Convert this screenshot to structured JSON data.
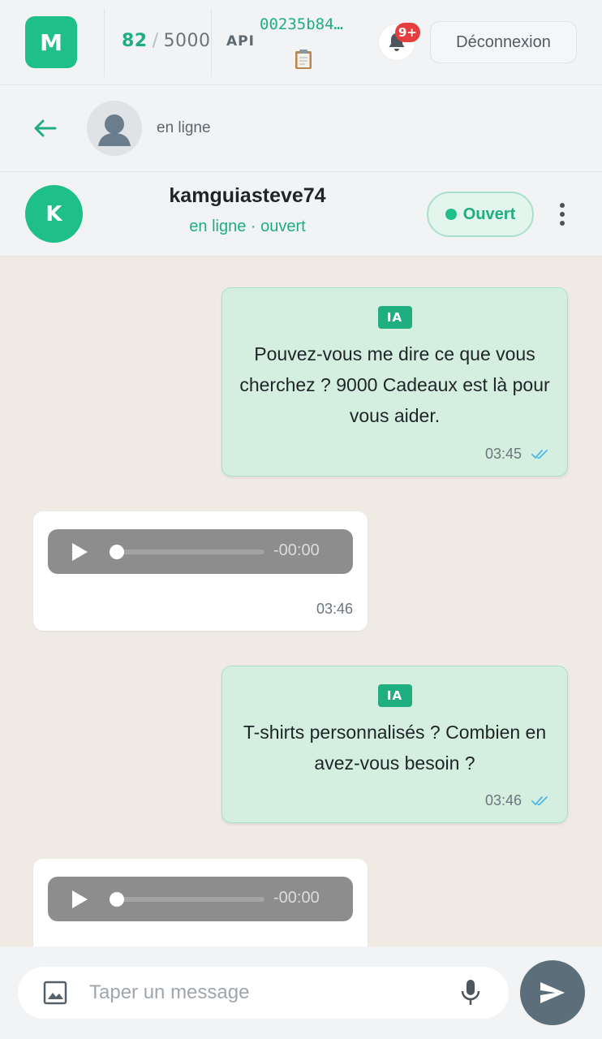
{
  "topbar": {
    "logo_letter": "M",
    "quota_used": "82",
    "quota_separator": "/",
    "quota_total": "5000",
    "api_label": "API",
    "api_key": "00235b84…",
    "notification_badge": "9+",
    "logout_label": "Déconnexion"
  },
  "subbar": {
    "status": "en ligne"
  },
  "contact": {
    "initial": "K",
    "name": "kamguiasteve74",
    "subtitle": "en ligne · ouvert",
    "status_pill": "Ouvert"
  },
  "messages": [
    {
      "direction": "out",
      "tag": "IA",
      "text": "Pouvez-vous me dire ce que vous cherchez ? 9000 Cadeaux est là pour vous aider.",
      "time": "03:45",
      "read": true
    },
    {
      "direction": "in",
      "type": "audio",
      "audio_time": "-00:00",
      "time": "03:46"
    },
    {
      "direction": "out",
      "tag": "IA",
      "text": "T-shirts personnalisés ? Combien en avez-vous besoin ?",
      "time": "03:46",
      "read": true
    },
    {
      "direction": "in",
      "type": "audio",
      "audio_time": "-00:00",
      "time": ""
    }
  ],
  "composer": {
    "placeholder": "Taper un message"
  },
  "colors": {
    "accent": "#1fbf8a",
    "outgoing_bubble": "#d4efe0",
    "chat_background": "#efebe4",
    "send_button": "#5c6e79",
    "badge": "#e63e3e"
  },
  "icons": [
    "clipboard-icon",
    "bell-icon",
    "back-arrow-icon",
    "user-silhouette-icon",
    "kebab-menu-icon",
    "play-icon",
    "double-check-icon",
    "image-icon",
    "microphone-icon",
    "send-icon"
  ]
}
